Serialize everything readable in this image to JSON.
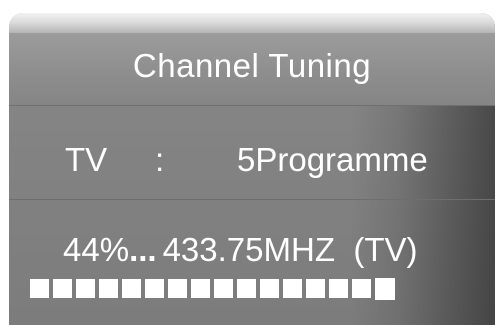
{
  "osd": {
    "title": "Channel Tuning",
    "source_label": "TV",
    "separator": ":",
    "programme": "5Programme",
    "scan_percent": "44%",
    "scan_ellipsis": "...",
    "frequency": "433.75MHZ",
    "band": "(TV)"
  },
  "progress": {
    "fraction": 0.44,
    "segments_total": 16
  },
  "colors": {
    "panel": "#858585",
    "text": "#ffffff",
    "bevel": "#dcdcdc"
  }
}
